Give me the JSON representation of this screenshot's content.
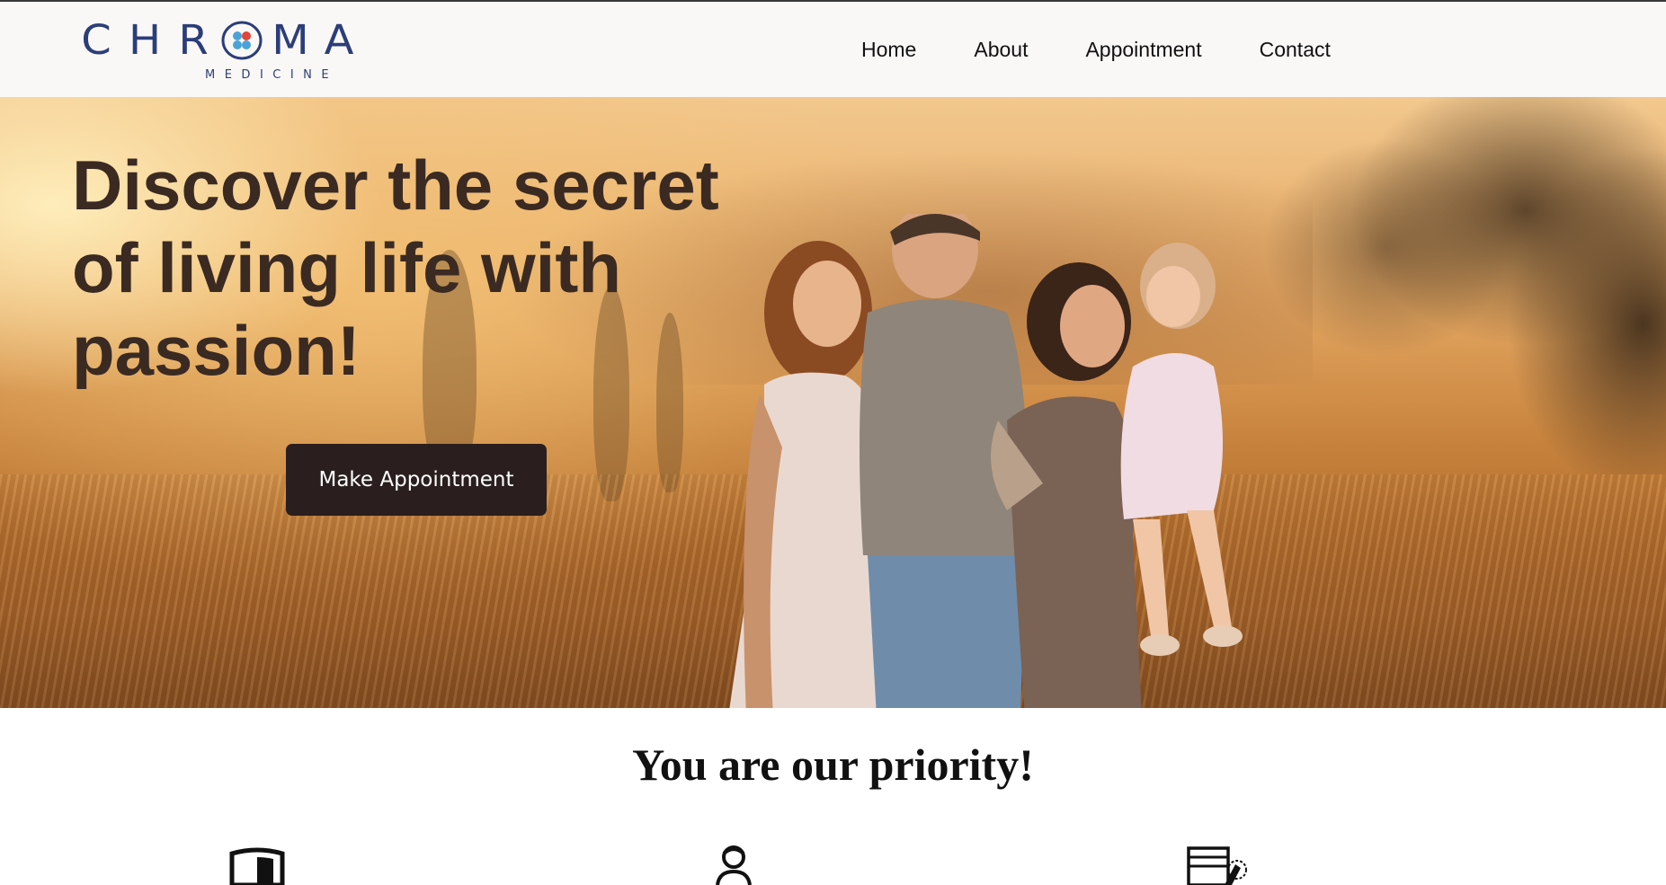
{
  "brand": {
    "letters_before": [
      "C",
      "H",
      "R"
    ],
    "letters_after": [
      "M",
      "A"
    ],
    "subtitle": "MEDICINE",
    "primary_color": "#2c3e78",
    "dot_colors": [
      "#4aa3d8",
      "#e2443a",
      "#4aa3d8",
      "#4aa3d8"
    ]
  },
  "nav": {
    "items": [
      {
        "label": "Home"
      },
      {
        "label": "About"
      },
      {
        "label": "Appointment"
      },
      {
        "label": "Contact"
      }
    ]
  },
  "hero": {
    "title": "Discover the secret of living life with passion!",
    "cta_label": "Make Appointment",
    "image": "family-in-sunlit-field"
  },
  "priority": {
    "heading": "You are our priority!",
    "icons": [
      "shield-icon",
      "doctor-icon",
      "medical-kit-icon"
    ]
  },
  "colors": {
    "heading": "#3a2a22",
    "button_bg": "#2a1f1e",
    "button_text": "#ffffff"
  }
}
